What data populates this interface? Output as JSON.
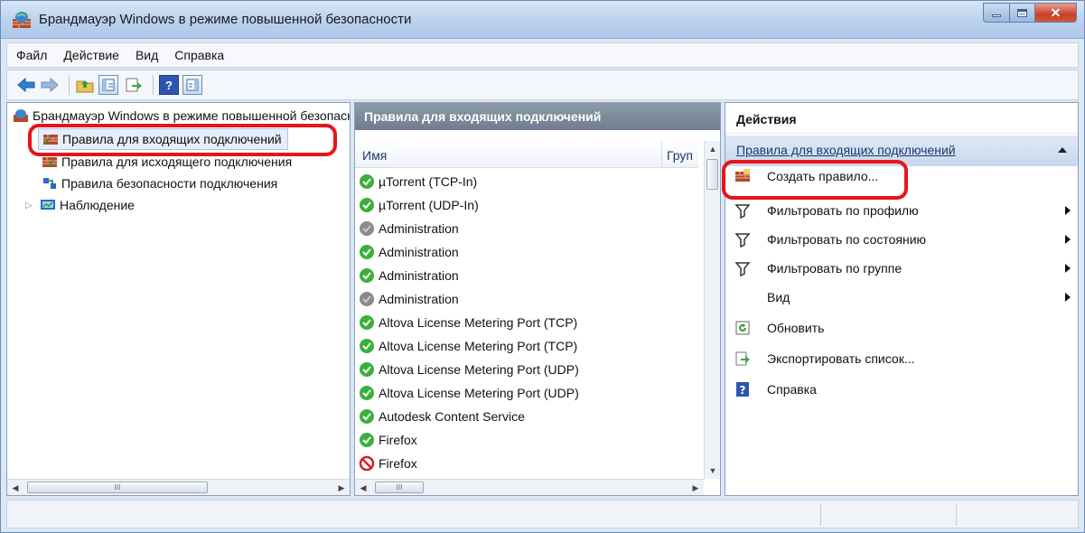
{
  "window": {
    "title": "Брандмауэр Windows в режиме повышенной безопасности"
  },
  "menubar": {
    "items": [
      "Файл",
      "Действие",
      "Вид",
      "Справка"
    ]
  },
  "toolbar": {
    "icons": [
      "back-icon",
      "forward-icon",
      "up-folder-icon",
      "show-hide-tree-icon",
      "export-icon",
      "help-icon",
      "show-hide-action-pane-icon"
    ]
  },
  "tree": {
    "items": [
      {
        "label": "Брандмауэр Windows в режиме повышенной безопасности",
        "icon": "firewall-icon"
      },
      {
        "label": "Правила для входящих подключений",
        "icon": "inbound-rules-icon"
      },
      {
        "label": "Правила для исходящего подключения",
        "icon": "outbound-rules-icon"
      },
      {
        "label": "Правила безопасности подключения",
        "icon": "connection-security-icon"
      },
      {
        "label": "Наблюдение",
        "icon": "monitoring-icon"
      }
    ],
    "scroll_thumb_label": "III"
  },
  "middle": {
    "header": "Правила для входящих подключений",
    "columns": [
      "Имя",
      "Груп"
    ],
    "rows": [
      {
        "name": "µTorrent (TCP-In)",
        "status": "enabled"
      },
      {
        "name": "µTorrent (UDP-In)",
        "status": "enabled"
      },
      {
        "name": "Administration",
        "status": "disabled"
      },
      {
        "name": "Administration",
        "status": "enabled"
      },
      {
        "name": "Administration",
        "status": "enabled"
      },
      {
        "name": "Administration",
        "status": "disabled"
      },
      {
        "name": "Altova License Metering Port (TCP)",
        "status": "enabled"
      },
      {
        "name": "Altova License Metering Port (TCP)",
        "status": "enabled"
      },
      {
        "name": "Altova License Metering Port (UDP)",
        "status": "enabled"
      },
      {
        "name": "Altova License Metering Port (UDP)",
        "status": "enabled"
      },
      {
        "name": "Autodesk Content Service",
        "status": "enabled"
      },
      {
        "name": "Firefox",
        "status": "enabled"
      },
      {
        "name": "Firefox",
        "status": "blocked"
      }
    ],
    "scroll_thumb_label": "III"
  },
  "actions": {
    "title": "Действия",
    "group_label": "Правила для входящих подключений",
    "items": [
      {
        "label": "Создать правило...",
        "icon": "new-rule-icon",
        "submenu": false
      },
      {
        "label": "Фильтровать по профилю",
        "icon": "filter-icon",
        "submenu": true
      },
      {
        "label": "Фильтровать по состоянию",
        "icon": "filter-icon",
        "submenu": true
      },
      {
        "label": "Фильтровать по группе",
        "icon": "filter-icon",
        "submenu": true
      },
      {
        "label": "Вид",
        "icon": "",
        "submenu": true
      },
      {
        "label": "Обновить",
        "icon": "refresh-icon",
        "submenu": false
      },
      {
        "label": "Экспортировать список...",
        "icon": "export-list-icon",
        "submenu": false
      },
      {
        "label": "Справка",
        "icon": "help-icon",
        "submenu": false
      }
    ]
  },
  "colors": {
    "highlight": "#e8141b",
    "enabled": "#3bb03b",
    "disabled": "#8a8a8a",
    "blocked": "#d0202a"
  }
}
